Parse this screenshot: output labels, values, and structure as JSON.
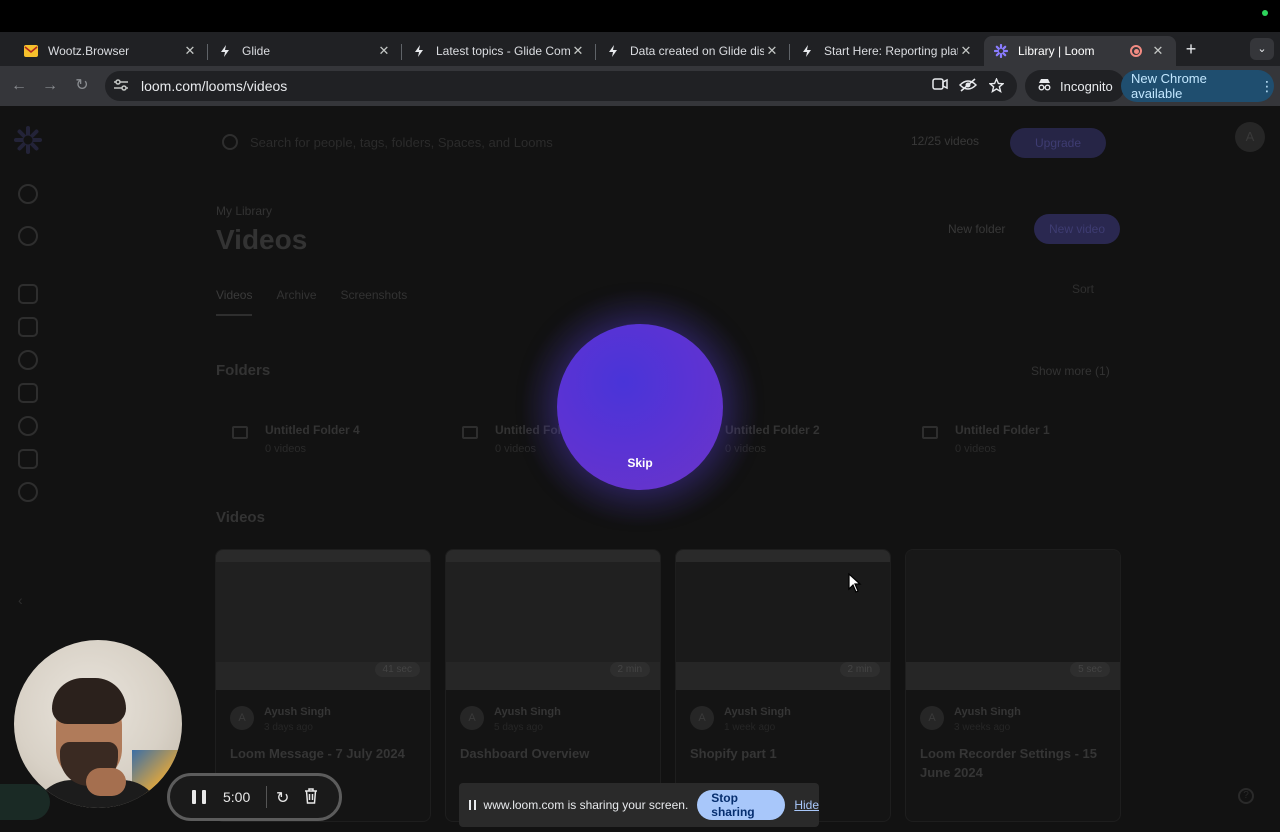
{
  "browser": {
    "tabs": [
      {
        "title": "Wootz.Browser",
        "icon": "gmail-icon",
        "active": false
      },
      {
        "title": "Glide",
        "icon": "glide-icon",
        "active": false
      },
      {
        "title": "Latest topics - Glide Comm",
        "icon": "glide-icon",
        "active": false
      },
      {
        "title": "Data created on Glide disa",
        "icon": "glide-icon",
        "active": false
      },
      {
        "title": "Start Here: Reporting platfo",
        "icon": "glide-icon",
        "active": false
      },
      {
        "title": "Library | Loom",
        "icon": "loom-icon",
        "active": true,
        "recording": true
      }
    ],
    "url": "loom.com/looms/videos",
    "incognito_label": "Incognito",
    "update_label": "New Chrome available",
    "accent": "#1f4e6f"
  },
  "loom": {
    "search_placeholder": "Search for people, tags, folders, Spaces, and Looms",
    "video_count": "12/25 videos",
    "upgrade_label": "Upgrade",
    "avatar_initial": "A",
    "breadcrumb": "My Library",
    "title": "Videos",
    "new_folder_label": "New folder",
    "new_video_label": "New video",
    "tabs": [
      "Videos",
      "Archive",
      "Screenshots"
    ],
    "sort_label": "Sort",
    "folders_heading": "Folders",
    "show_more_label": "Show more (1)",
    "folders": [
      {
        "name": "Untitled Folder 4",
        "count": "0 videos"
      },
      {
        "name": "Untitled Folder 3",
        "count": "0 videos"
      },
      {
        "name": "Untitled Folder 2",
        "count": "0 videos"
      },
      {
        "name": "Untitled Folder 1",
        "count": "0 videos"
      }
    ],
    "videos_heading": "Videos",
    "videos": [
      {
        "owner": "Ayush Singh",
        "ago": "3 days ago",
        "duration": "41 sec",
        "title": "Loom Message - 7 July 2024"
      },
      {
        "owner": "Ayush Singh",
        "ago": "5 days ago",
        "duration": "2 min",
        "title": "Dashboard Overview"
      },
      {
        "owner": "Ayush Singh",
        "ago": "1 week ago",
        "duration": "2 min",
        "title": "Shopify part 1"
      },
      {
        "owner": "Ayush Singh",
        "ago": "3 weeks ago",
        "duration": "5 sec",
        "title": "Loom Recorder Settings - 15 June 2024"
      }
    ]
  },
  "countdown": {
    "skip_label": "Skip",
    "orb_color": "#5a33d4"
  },
  "recorder": {
    "timer": "5:00"
  },
  "share_bar": {
    "message": "www.loom.com is sharing your screen.",
    "stop_label": "Stop sharing",
    "hide_label": "Hide",
    "stop_color": "#a8c7fa"
  }
}
